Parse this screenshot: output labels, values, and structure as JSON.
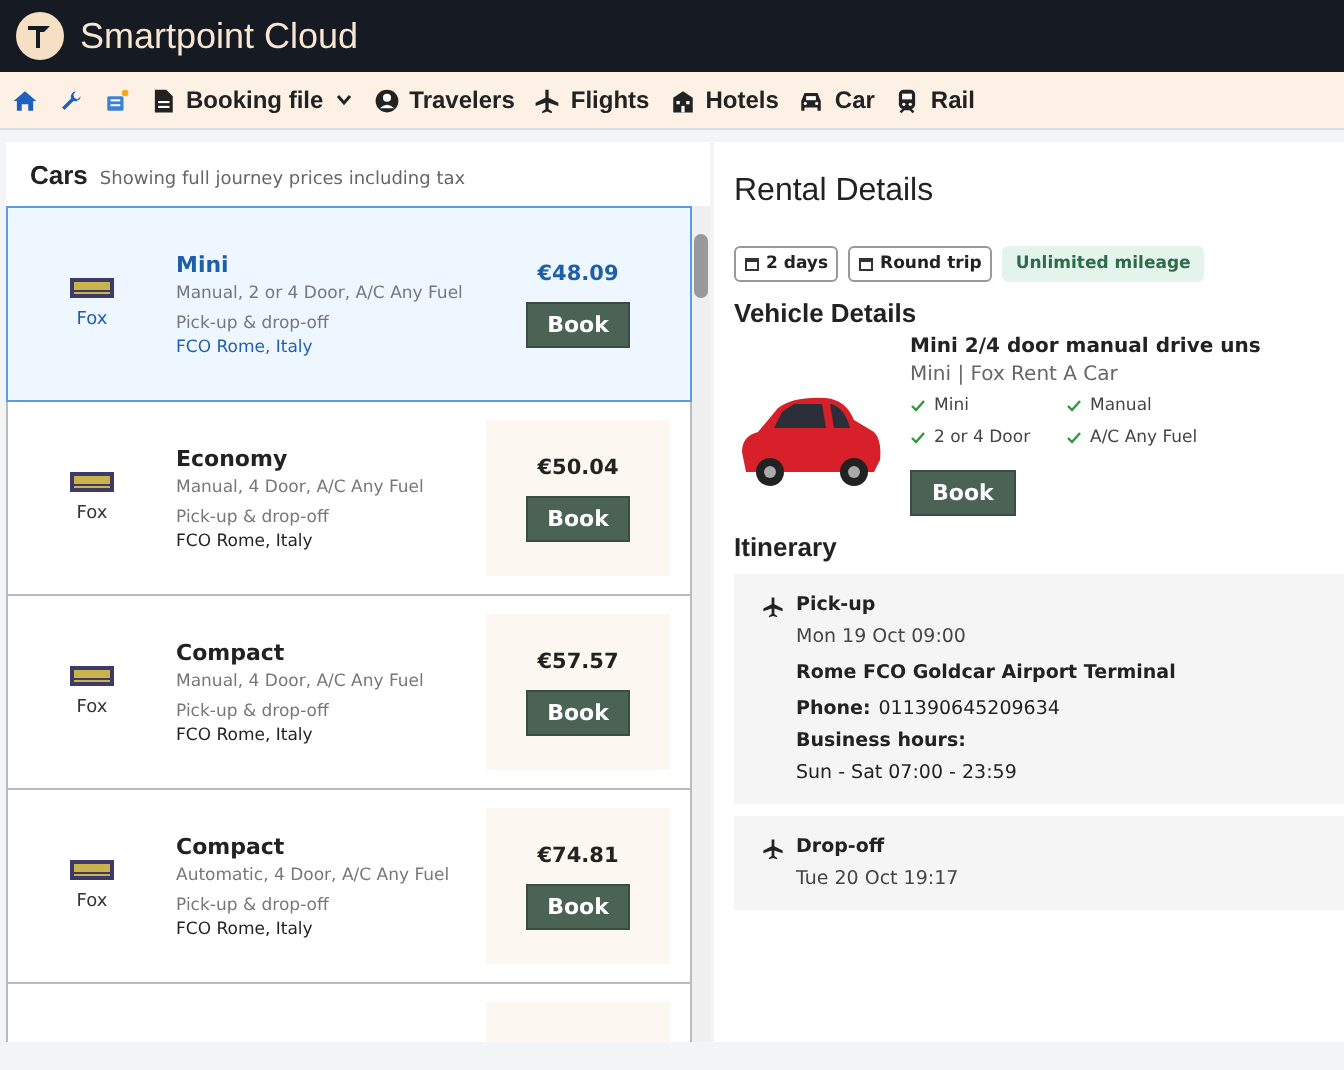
{
  "app": {
    "title": "Smartpoint Cloud"
  },
  "nav": [
    {
      "kind": "home"
    },
    {
      "kind": "tools"
    },
    {
      "kind": "queue"
    },
    {
      "kind": "file",
      "label": "Booking file",
      "dropdown": true
    },
    {
      "kind": "traveler",
      "label": "Travelers"
    },
    {
      "kind": "plane",
      "label": "Flights"
    },
    {
      "kind": "hotel",
      "label": "Hotels"
    },
    {
      "kind": "car",
      "label": "Car"
    },
    {
      "kind": "rail",
      "label": "Rail"
    }
  ],
  "results": {
    "title": "Cars",
    "subtitle": "Showing full journey prices including tax",
    "cars": [
      {
        "name": "Mini",
        "specs": "Manual, 2 or 4 Door, A/C Any Fuel",
        "service": "Pick-up & drop-off",
        "location": "FCO Rome, Italy",
        "vendor": "Fox",
        "price": "€48.09",
        "action": "Book",
        "selected": true
      },
      {
        "name": "Economy",
        "specs": "Manual, 4 Door, A/C Any Fuel",
        "service": "Pick-up & drop-off",
        "location": "FCO Rome, Italy",
        "vendor": "Fox",
        "price": "€50.04",
        "action": "Book",
        "selected": false
      },
      {
        "name": "Compact",
        "specs": "Manual, 4 Door, A/C Any Fuel",
        "service": "Pick-up & drop-off",
        "location": "FCO Rome, Italy",
        "vendor": "Fox",
        "price": "€57.57",
        "action": "Book",
        "selected": false
      },
      {
        "name": "Compact",
        "specs": "Automatic, 4 Door, A/C Any Fuel",
        "service": "Pick-up & drop-off",
        "location": "FCO Rome, Italy",
        "vendor": "Fox",
        "price": "€74.81",
        "action": "Book",
        "selected": false
      }
    ]
  },
  "details": {
    "title": "Rental Details",
    "tags": [
      {
        "kind": "calendar",
        "label": "2 days"
      },
      {
        "kind": "calendar",
        "label": "Round trip"
      },
      {
        "kind": "highlight",
        "label": "Unlimited mileage"
      }
    ],
    "vehicle_heading": "Vehicle Details",
    "vehicle_name": "Mini 2/4 door manual drive uns",
    "vehicle_sub": "Mini | Fox Rent A Car",
    "features": [
      "Mini",
      "Manual",
      "2 or 4 Door",
      "A/C Any Fuel"
    ],
    "action": "Book",
    "itinerary_heading": "Itinerary",
    "itinerary": [
      {
        "title": "Pick-up",
        "time": "Mon 19 Oct 09:00",
        "place": "Rome FCO Goldcar Airport Terminal",
        "phone_label": "Phone:",
        "phone": "011390645209634",
        "hours_label": "Business hours:",
        "hours": "Sun - Sat 07:00 - 23:59"
      },
      {
        "title": "Drop-off",
        "time": "Tue 20 Oct 19:17"
      }
    ]
  }
}
